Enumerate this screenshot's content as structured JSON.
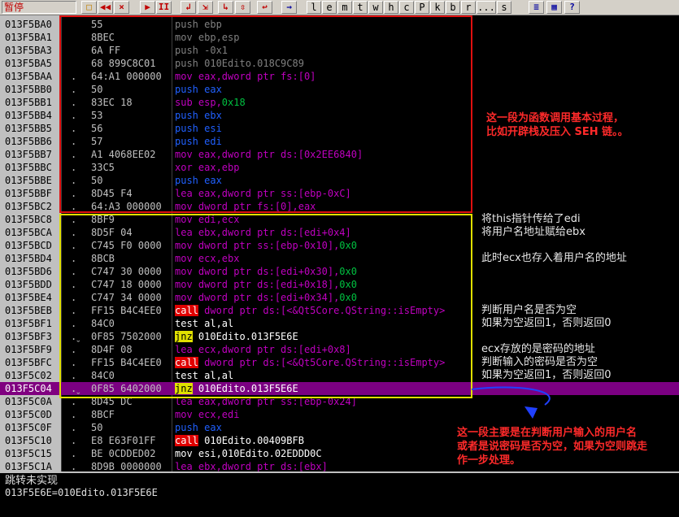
{
  "status": "暂停",
  "toolbar": {
    "buttons": [
      {
        "label": "",
        "icon": "open-folder-icon"
      },
      {
        "label": "◀◀",
        "icon": "rewind-icon"
      },
      {
        "label": "×",
        "icon": "close-icon"
      },
      {
        "label": "▶",
        "icon": "run-icon"
      },
      {
        "label": "II",
        "icon": "pause-icon"
      },
      {
        "label": "↲",
        "icon": "step-into-icon"
      },
      {
        "label": "⇲",
        "icon": "step-over-icon"
      },
      {
        "label": "↳",
        "icon": "trace-into-icon"
      },
      {
        "label": "⇳",
        "icon": "trace-over-icon"
      },
      {
        "label": "↩",
        "icon": "execute-till-return-icon"
      },
      {
        "label": "→",
        "icon": "goto-icon"
      }
    ],
    "letters": [
      "l",
      "e",
      "m",
      "t",
      "w",
      "h",
      "c",
      "P",
      "k",
      "b",
      "r",
      "...",
      "s"
    ]
  },
  "rows": [
    {
      "addr": "013F5BA0",
      "mark": "",
      "hex": "55",
      "asm": [
        [
          "push ebp",
          "c-push"
        ]
      ],
      "cmt": ""
    },
    {
      "addr": "013F5BA1",
      "mark": "",
      "hex": "8BEC",
      "asm": [
        [
          "mov ebp,esp",
          "c-push"
        ]
      ],
      "cmt": ""
    },
    {
      "addr": "013F5BA3",
      "mark": "",
      "hex": "6A FF",
      "asm": [
        [
          "push -0x1",
          "c-push"
        ]
      ],
      "cmt": ""
    },
    {
      "addr": "013F5BA5",
      "mark": "",
      "hex": "68 899C8C01",
      "asm": [
        [
          "push 010Edito.018C9C89",
          "c-push"
        ]
      ],
      "cmt": ""
    },
    {
      "addr": "013F5BAA",
      "mark": ".",
      "hex": "64:A1 000000",
      "asm": [
        [
          "mov eax,dword ptr fs:[0]",
          "c-purple"
        ]
      ],
      "cmt": ""
    },
    {
      "addr": "013F5BB0",
      "mark": ".",
      "hex": "50",
      "asm": [
        [
          "push eax",
          "c-blue"
        ]
      ],
      "cmt": ""
    },
    {
      "addr": "013F5BB1",
      "mark": ".",
      "hex": "83EC 18",
      "asm": [
        [
          "sub esp,",
          "c-purple"
        ],
        [
          "0x18",
          "c-green"
        ]
      ],
      "cmt": ""
    },
    {
      "addr": "013F5BB4",
      "mark": ".",
      "hex": "53",
      "asm": [
        [
          "push ebx",
          "c-blue"
        ]
      ],
      "cmt": ""
    },
    {
      "addr": "013F5BB5",
      "mark": ".",
      "hex": "56",
      "asm": [
        [
          "push esi",
          "c-blue"
        ]
      ],
      "cmt": ""
    },
    {
      "addr": "013F5BB6",
      "mark": ".",
      "hex": "57",
      "asm": [
        [
          "push edi",
          "c-blue"
        ]
      ],
      "cmt": ""
    },
    {
      "addr": "013F5BB7",
      "mark": ".",
      "hex": "A1 4068EE02",
      "asm": [
        [
          "mov eax,dword ptr ds:[0x2EE6840]",
          "c-purple"
        ]
      ],
      "cmt": ""
    },
    {
      "addr": "013F5BBC",
      "mark": ".",
      "hex": "33C5",
      "asm": [
        [
          "xor eax,ebp",
          "c-purple"
        ]
      ],
      "cmt": ""
    },
    {
      "addr": "013F5BBE",
      "mark": ".",
      "hex": "50",
      "asm": [
        [
          "push eax",
          "c-blue"
        ]
      ],
      "cmt": ""
    },
    {
      "addr": "013F5BBF",
      "mark": ".",
      "hex": "8D45 F4",
      "asm": [
        [
          "lea eax,dword ptr ss:[ebp-0xC]",
          "c-purple"
        ]
      ],
      "cmt": ""
    },
    {
      "addr": "013F5BC2",
      "mark": ".",
      "hex": "64:A3 000000",
      "asm": [
        [
          "mov dword ptr fs:[0],eax",
          "c-purple"
        ]
      ],
      "cmt": ""
    },
    {
      "addr": "013F5BC8",
      "mark": ".",
      "hex": "8BF9",
      "asm": [
        [
          "mov edi,ecx",
          "c-purple"
        ]
      ],
      "cmt": "将this指针传给了edi"
    },
    {
      "addr": "013F5BCA",
      "mark": ".",
      "hex": "8D5F 04",
      "asm": [
        [
          "lea ebx,dword ptr ds:[edi+0x4]",
          "c-purple"
        ]
      ],
      "cmt": "将用户名地址赋给ebx"
    },
    {
      "addr": "013F5BCD",
      "mark": ".",
      "hex": "C745 F0 0000",
      "asm": [
        [
          "mov dword ptr ss:[ebp-0x10],",
          "c-purple"
        ],
        [
          "0x0",
          "c-green"
        ]
      ],
      "cmt": ""
    },
    {
      "addr": "013F5BD4",
      "mark": ".",
      "hex": "8BCB",
      "asm": [
        [
          "mov ecx,ebx",
          "c-purple"
        ]
      ],
      "cmt": "此时ecx也存入着用户名的地址"
    },
    {
      "addr": "013F5BD6",
      "mark": ".",
      "hex": "C747 30 0000",
      "asm": [
        [
          "mov dword ptr ds:[edi+0x30],",
          "c-purple"
        ],
        [
          "0x0",
          "c-green"
        ]
      ],
      "cmt": ""
    },
    {
      "addr": "013F5BDD",
      "mark": ".",
      "hex": "C747 18 0000",
      "asm": [
        [
          "mov dword ptr ds:[edi+0x18],",
          "c-purple"
        ],
        [
          "0x0",
          "c-green"
        ]
      ],
      "cmt": ""
    },
    {
      "addr": "013F5BE4",
      "mark": ".",
      "hex": "C747 34 0000",
      "asm": [
        [
          "mov dword ptr ds:[edi+0x34],",
          "c-purple"
        ],
        [
          "0x0",
          "c-green"
        ]
      ],
      "cmt": ""
    },
    {
      "addr": "013F5BEB",
      "mark": ".",
      "hex": "FF15 B4C4EE0",
      "asm": [
        [
          "call",
          "c-red-bg"
        ],
        [
          " dword ptr ds:[<&Qt5Core.QString::isEmpty>",
          "c-purple"
        ]
      ],
      "cmt": "判断用户名是否为空"
    },
    {
      "addr": "013F5BF1",
      "mark": ".",
      "hex": "84C0",
      "asm": [
        [
          "test al,al",
          "c-white"
        ]
      ],
      "cmt": "如果为空返回1，否则返回0"
    },
    {
      "addr": "013F5BF3",
      "mark": ".ˬ",
      "hex": "0F85 7502000",
      "asm": [
        [
          "jnz",
          "c-yel-bg"
        ],
        [
          " 010Edito.013F5E6E",
          "c-white"
        ]
      ],
      "cmt": ""
    },
    {
      "addr": "013F5BF9",
      "mark": ".",
      "hex": "8D4F 08",
      "asm": [
        [
          "lea ecx,dword ptr ds:[edi+0x8]",
          "c-purple"
        ]
      ],
      "cmt": "ecx存放的是密码的地址"
    },
    {
      "addr": "013F5BFC",
      "mark": ".",
      "hex": "FF15 B4C4EE0",
      "asm": [
        [
          "call",
          "c-red-bg"
        ],
        [
          " dword ptr ds:[<&Qt5Core.QString::isEmpty>",
          "c-purple"
        ]
      ],
      "cmt": "判断输入的密码是否为空"
    },
    {
      "addr": "013F5C02",
      "mark": ".",
      "hex": "84C0",
      "asm": [
        [
          "test al,al",
          "c-white"
        ]
      ],
      "cmt": "如果为空返回1，否则返回0"
    },
    {
      "addr": "013F5C04",
      "mark": ".ˬ",
      "hex": "0F85 6402000",
      "asm": [
        [
          "jnz",
          "c-yel-bg"
        ],
        [
          " 010Edito.013F5E6E",
          "c-white"
        ]
      ],
      "cmt": "",
      "selected": true
    },
    {
      "addr": "013F5C0A",
      "mark": ".",
      "hex": "8D45 DC",
      "asm": [
        [
          "lea eax,dword ptr ss:[ebp-0x24]",
          "c-purple"
        ]
      ],
      "cmt": ""
    },
    {
      "addr": "013F5C0D",
      "mark": ".",
      "hex": "8BCF",
      "asm": [
        [
          "mov ecx,edi",
          "c-purple"
        ]
      ],
      "cmt": ""
    },
    {
      "addr": "013F5C0F",
      "mark": ".",
      "hex": "50",
      "asm": [
        [
          "push eax",
          "c-blue"
        ]
      ],
      "cmt": ""
    },
    {
      "addr": "013F5C10",
      "mark": ".",
      "hex": "E8 E63F01FF",
      "asm": [
        [
          "call",
          "c-red-bg"
        ],
        [
          " 010Edito.00409BFB",
          "c-white"
        ]
      ],
      "cmt": ""
    },
    {
      "addr": "013F5C15",
      "mark": ".",
      "hex": "BE 0CDDED02",
      "asm": [
        [
          "mov esi,010Edito.02EDDD0C",
          "c-white"
        ]
      ],
      "cmt": ""
    },
    {
      "addr": "013F5C1A",
      "mark": ".",
      "hex": "8D9B 0000000",
      "asm": [
        [
          "lea ebx,dword ptr ds:[ebx]",
          "c-purple"
        ]
      ],
      "cmt": ""
    }
  ],
  "annotations": {
    "red_note": "这一段为函数调用基本过程，\n比如开辟栈及压入 SEH 链。。",
    "bottom_note": "这一段主要是在判断用户输入的用户名\n或者是说密码是否为空，如果为空则跳走\n作一步处理。"
  },
  "info": {
    "line1": "跳转未实现",
    "line2": "013F5E6E=010Edito.013F5E6E"
  },
  "colors": {
    "selected_row": "#7b0082",
    "red_box": "#e01010",
    "yellow_box": "#e0e000",
    "note_red": "#ff2a2a"
  }
}
